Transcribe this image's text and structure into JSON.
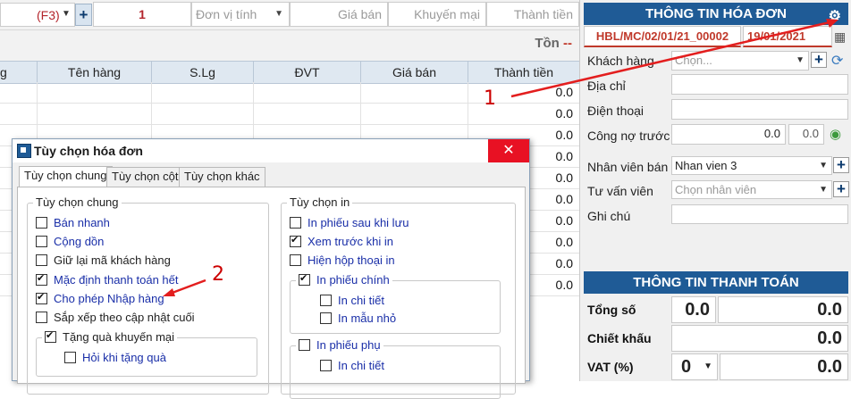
{
  "entry_bar": {
    "search_hint": "(F3)",
    "quantity": "1",
    "unit_placeholder": "Đơn vị tính",
    "price_placeholder": "Giá bán",
    "promo_placeholder": "Khuyến mại",
    "total_placeholder": "Thành tiền"
  },
  "stock": {
    "label": "Tồn",
    "value": "--"
  },
  "grid": {
    "columns": [
      "g",
      "Tên hàng",
      "S.Lg",
      "ĐVT",
      "Giá bán",
      "Thành tiền"
    ],
    "row_totals": [
      "0.0",
      "0.0",
      "0.0",
      "0.0",
      "0.0",
      "0.0",
      "0.0",
      "0.0",
      "0.0",
      "0.0"
    ]
  },
  "invoice": {
    "title": "THÔNG TIN HÓA ĐƠN",
    "number": "HBL/MC/02/01/21_00002",
    "date": "19/01/2021",
    "customer_label": "Khách hàng",
    "customer_placeholder": "Chọn...",
    "address_label": "Địa chỉ",
    "phone_label": "Điện thoại",
    "debt_label": "Công nợ trước",
    "debt_value": "0.0",
    "debt_value2": "0.0",
    "staff_label": "Nhân viên bán",
    "staff_value": "Nhan vien 3",
    "advisor_label": "Tư vấn viên",
    "advisor_placeholder": "Chọn nhân viên",
    "note_label": "Ghi chú"
  },
  "payment": {
    "title": "THÔNG TIN THANH TOÁN",
    "total_label": "Tổng số",
    "total_qty": "0.0",
    "total_amount": "0.0",
    "discount_label": "Chiết khấu",
    "discount_amount": "0.0",
    "vat_label": "VAT (%)",
    "vat_rate": "0",
    "vat_amount": "0.0"
  },
  "dialog": {
    "title": "Tùy chọn hóa đơn",
    "close": "✕",
    "tabs": [
      "Tùy chọn chung",
      "Tùy chọn cột",
      "Tùy chọn khác"
    ],
    "general": {
      "title": "Tùy chọn chung",
      "items": [
        {
          "label": "Bán nhanh",
          "checked": false
        },
        {
          "label": "Cộng dồn",
          "checked": false
        },
        {
          "label": "Giữ lại mã khách hàng",
          "checked": false
        },
        {
          "label": "Mặc định thanh toán hết",
          "checked": true
        },
        {
          "label": "Cho phép Nhập hàng",
          "checked": true
        },
        {
          "label": "Sắp xếp theo cập nhật cuối",
          "checked": false
        }
      ],
      "promo_group": "Tặng quà khuyến mại",
      "promo_item": "Hỏi khi tặng quà"
    },
    "print": {
      "title": "Tùy chọn in",
      "items": [
        {
          "label": "In phiếu sau khi lưu",
          "checked": false
        },
        {
          "label": "Xem trước khi in",
          "checked": true
        },
        {
          "label": "Hiện hộp thoại in",
          "checked": false
        }
      ],
      "main_group": "In phiếu chính",
      "main_items": [
        "In chi tiết",
        "In mẫu nhỏ"
      ],
      "sub_group": "In phiếu phụ",
      "sub_items": [
        "In chi tiết"
      ]
    }
  },
  "annotations": {
    "one": "1",
    "two": "2"
  }
}
